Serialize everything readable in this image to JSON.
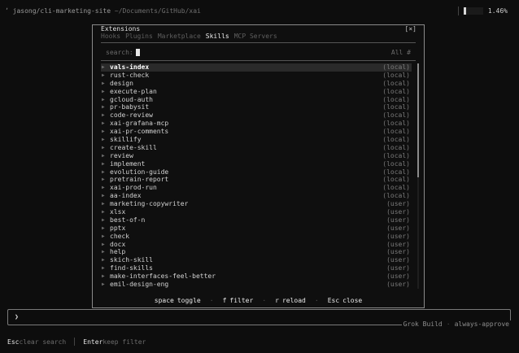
{
  "topbar": {
    "prefix": "ʼ",
    "project": "jasong/cli-marketing-site",
    "path": "~/Documents/GitHub/xai"
  },
  "usage": {
    "percent_label": "1.46%",
    "fraction": 0.0146
  },
  "modal": {
    "title": "Extensions",
    "close_label": "[×]",
    "tabs": [
      "Hooks",
      "Plugins",
      "Marketplace",
      "Skills",
      "MCP Servers"
    ],
    "active_tab": "Skills",
    "search_label": "search:",
    "filter_label": "All #"
  },
  "skills": [
    {
      "name": "vals-index",
      "scope": "(local)"
    },
    {
      "name": "rust-check",
      "scope": "(local)"
    },
    {
      "name": "design",
      "scope": "(local)"
    },
    {
      "name": "execute-plan",
      "scope": "(local)"
    },
    {
      "name": "gcloud-auth",
      "scope": "(local)"
    },
    {
      "name": "pr-babysit",
      "scope": "(local)"
    },
    {
      "name": "code-review",
      "scope": "(local)"
    },
    {
      "name": "xai-grafana-mcp",
      "scope": "(local)"
    },
    {
      "name": "xai-pr-comments",
      "scope": "(local)"
    },
    {
      "name": "skillify",
      "scope": "(local)"
    },
    {
      "name": "create-skill",
      "scope": "(local)"
    },
    {
      "name": "review",
      "scope": "(local)"
    },
    {
      "name": "implement",
      "scope": "(local)"
    },
    {
      "name": "evolution-guide",
      "scope": "(local)"
    },
    {
      "name": "pretrain-report",
      "scope": "(local)"
    },
    {
      "name": "xai-prod-run",
      "scope": "(local)"
    },
    {
      "name": "aa-index",
      "scope": "(local)"
    },
    {
      "name": "marketing-copywriter",
      "scope": "(user)"
    },
    {
      "name": "xlsx",
      "scope": "(user)"
    },
    {
      "name": "best-of-n",
      "scope": "(user)"
    },
    {
      "name": "pptx",
      "scope": "(user)"
    },
    {
      "name": "check",
      "scope": "(user)"
    },
    {
      "name": "docx",
      "scope": "(user)"
    },
    {
      "name": "help",
      "scope": "(user)"
    },
    {
      "name": "skich-skill",
      "scope": "(user)"
    },
    {
      "name": "find-skills",
      "scope": "(user)"
    },
    {
      "name": "make-interfaces-feel-better",
      "scope": "(user)"
    },
    {
      "name": "emil-design-eng",
      "scope": "(user)"
    }
  ],
  "footer": [
    {
      "key": "space",
      "action": "toggle"
    },
    {
      "key": "f",
      "action": "filter"
    },
    {
      "key": "r",
      "action": "reload"
    },
    {
      "key": "Esc",
      "action": "close"
    }
  ],
  "input": {
    "prompt": "❯"
  },
  "status": {
    "mode": "Grok Build",
    "approval": "always-approve"
  },
  "hints": [
    {
      "key": "Esc",
      "text": "clear search"
    },
    {
      "key": "Enter",
      "text": "keep filter"
    }
  ]
}
